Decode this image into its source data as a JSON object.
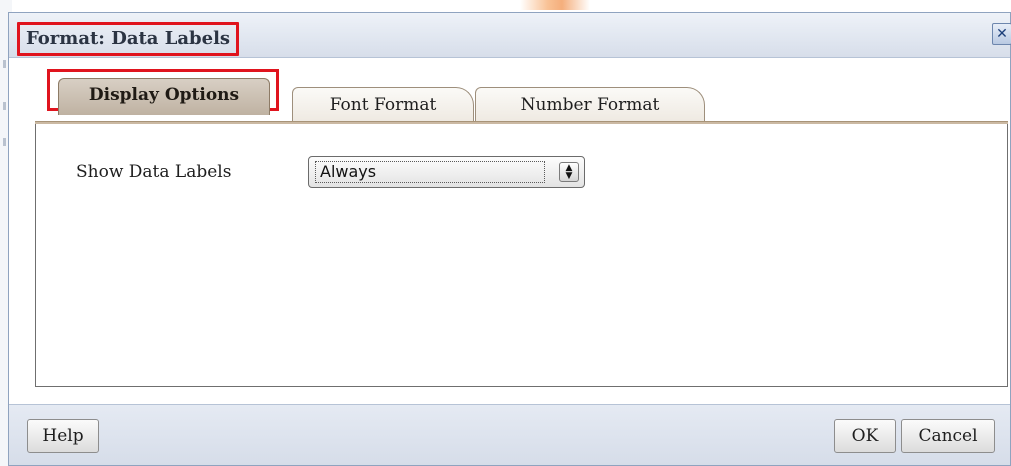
{
  "dialog": {
    "title": "Format: Data Labels",
    "close_icon": "close-icon"
  },
  "tabs": [
    {
      "label": "Display Options",
      "active": true
    },
    {
      "label": "Font Format",
      "active": false
    },
    {
      "label": "Number Format",
      "active": false
    }
  ],
  "display_options": {
    "show_data_labels_label": "Show Data Labels",
    "show_data_labels_value": "Always"
  },
  "footer": {
    "help_label": "Help",
    "ok_label": "OK",
    "cancel_label": "Cancel"
  },
  "colors": {
    "highlight": "#e0141e",
    "titlebar": "#dce3ee",
    "active_tab": "#c9bdae"
  }
}
